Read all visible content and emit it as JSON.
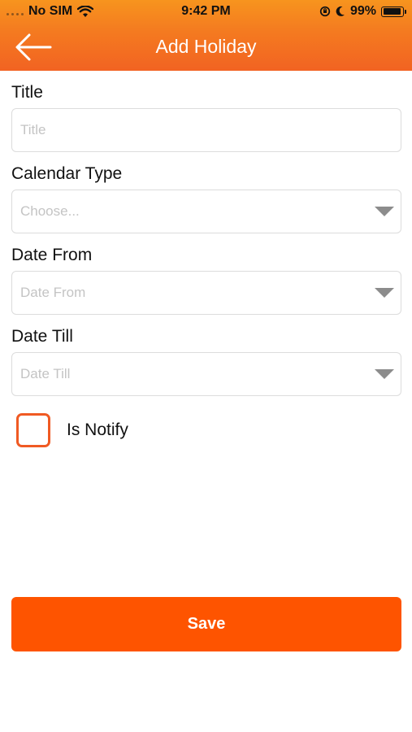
{
  "status_bar": {
    "carrier": "No SIM",
    "time": "9:42 PM",
    "battery": "99%",
    "icons": [
      "signal-dots-icon",
      "wifi-icon",
      "orientation-lock-icon",
      "moon-icon",
      "battery-icon"
    ]
  },
  "header": {
    "title": "Add Holiday",
    "back_icon": "arrow-left-icon",
    "colors": {
      "gradient_top": "#f7941e",
      "gradient_bottom": "#f26322"
    }
  },
  "form": {
    "title": {
      "label": "Title",
      "placeholder": "Title",
      "value": ""
    },
    "calendar_type": {
      "label": "Calendar Type",
      "placeholder": "Choose...",
      "selected": ""
    },
    "date_from": {
      "label": "Date From",
      "placeholder": "Date From",
      "value": ""
    },
    "date_till": {
      "label": "Date Till",
      "placeholder": "Date Till",
      "value": ""
    },
    "is_notify": {
      "label": "Is Notify",
      "checked": false
    }
  },
  "save": {
    "label": "Save",
    "color": "#fe5400"
  },
  "theme": {
    "accent": "#f05a23",
    "placeholder_color": "#c4c4c4",
    "border_color": "#dcdcdc"
  }
}
